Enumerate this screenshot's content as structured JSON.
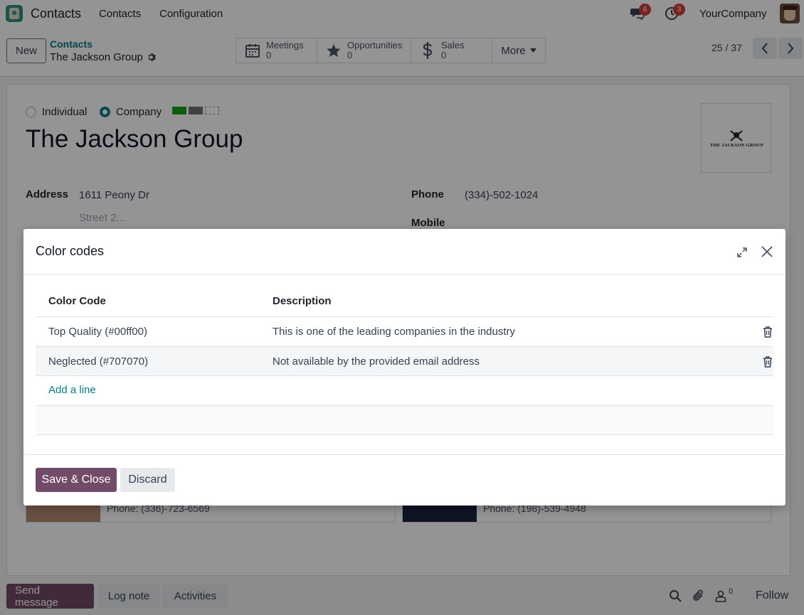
{
  "navbar": {
    "app_name": "Contacts",
    "menu": [
      "Contacts",
      "Configuration"
    ],
    "messages_badge": "6",
    "activities_badge": "3",
    "company": "YourCompany"
  },
  "control_panel": {
    "new_label": "New",
    "breadcrumb_parent": "Contacts",
    "breadcrumb_current": "The Jackson Group",
    "smart_buttons": [
      {
        "label": "Meetings",
        "count": "0",
        "icon": "calendar-icon"
      },
      {
        "label": "Opportunities",
        "count": "0",
        "icon": "star-icon"
      },
      {
        "label": "Sales",
        "count": "0",
        "icon": "dollar-icon"
      }
    ],
    "more_label": "More",
    "pager": "25 / 37"
  },
  "form": {
    "type_options": [
      "Individual",
      "Company"
    ],
    "selected_type": "Company",
    "tag_colors": [
      "#00ff00",
      "#707070",
      "#ffffff"
    ],
    "name": "The Jackson Group",
    "logo_text": "The Jackson Group",
    "address_label": "Address",
    "street": "1611 Peony Dr",
    "street2_placeholder": "Street 2...",
    "phone_label": "Phone",
    "phone": "(334)-502-1024",
    "mobile_label": "Mobile",
    "contact_cards": [
      {
        "phone": "Phone: (336)-723-6569"
      },
      {
        "phone": "Phone: (198)-539-4948"
      }
    ]
  },
  "chatter": {
    "send_message": "Send message",
    "log_note": "Log note",
    "activities": "Activities",
    "followers_count": "0",
    "follow": "Follow"
  },
  "dialog": {
    "title": "Color codes",
    "columns": [
      "Color Code",
      "Description"
    ],
    "rows": [
      {
        "code": "Top Quality (#00ff00)",
        "description": "This is one of the leading companies in the industry"
      },
      {
        "code": "Neglected (#707070)",
        "description": "Not available by the provided email address"
      }
    ],
    "add_line": "Add a line",
    "save_close": "Save & Close",
    "discard": "Discard"
  },
  "colors": {
    "brand": "#714b67",
    "link": "#017e84",
    "badge": "#d23f3a"
  }
}
